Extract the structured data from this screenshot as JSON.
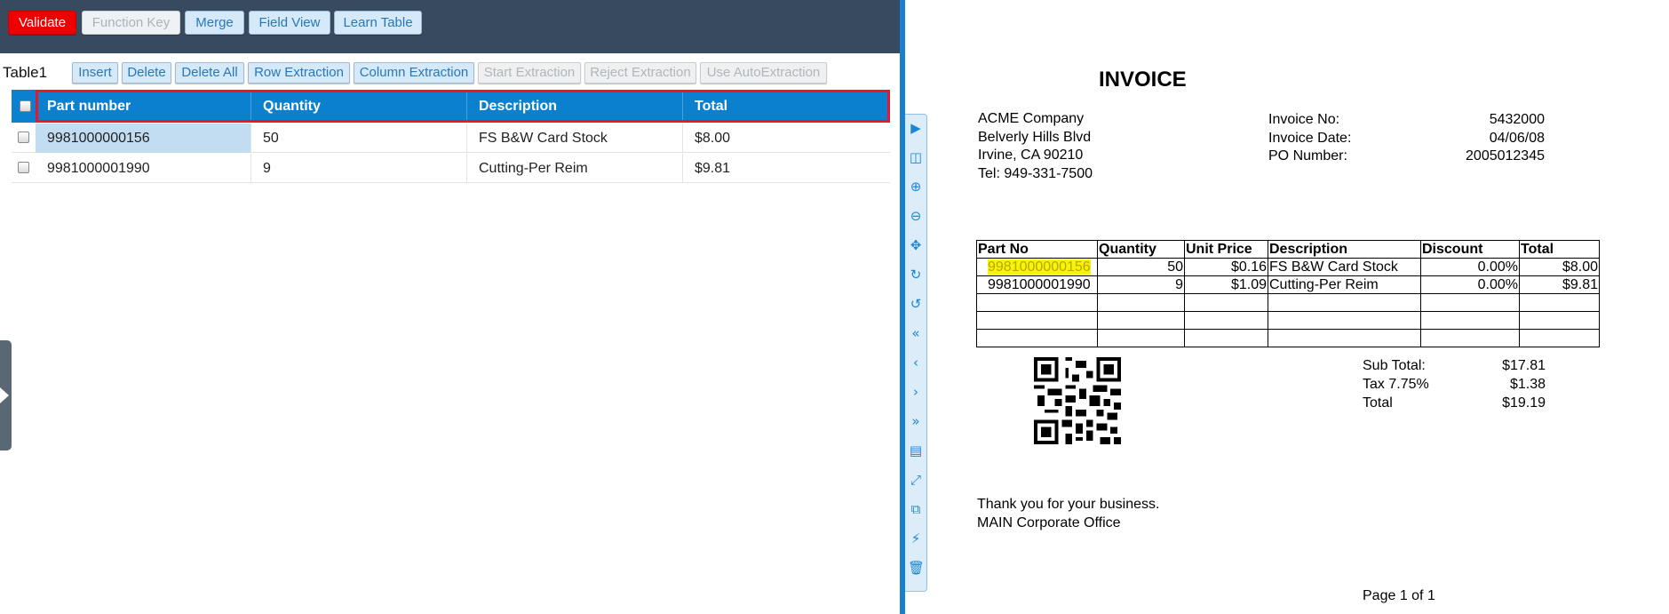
{
  "toolbar": {
    "validate": "Validate",
    "function_key": "Function Key",
    "merge": "Merge",
    "field_view": "Field View",
    "learn_table": "Learn Table"
  },
  "table": {
    "name": "Table1",
    "actions": {
      "insert": "Insert",
      "delete": "Delete",
      "delete_all": "Delete All",
      "row_extraction": "Row Extraction",
      "column_extraction": "Column Extraction",
      "start_extraction": "Start Extraction",
      "reject_extraction": "Reject Extraction",
      "use_autoextraction": "Use AutoExtraction"
    },
    "columns": [
      "Part number",
      "Quantity",
      "Description",
      "Total"
    ],
    "rows": [
      [
        "9981000000156",
        "50",
        "FS B&W Card Stock",
        "$8.00"
      ],
      [
        "9981000001990",
        "9",
        "Cutting-Per Reim",
        "$9.81"
      ]
    ]
  },
  "viewer_tools": [
    "play-icon",
    "split-view-icon",
    "zoom-in-icon",
    "zoom-out-icon",
    "pan-icon",
    "rotate-cw-icon",
    "rotate-ccw-icon",
    "first-page-icon",
    "prev-page-icon",
    "next-page-icon",
    "last-page-icon",
    "document-icon",
    "fit-icon",
    "copy-icon",
    "plug-icon",
    "trash-icon"
  ],
  "document": {
    "title": "INVOICE",
    "company": {
      "name": "ACME Company",
      "street": "Belverly Hills Blvd",
      "city": "Irvine, CA 90210",
      "tel": "Tel: 949-331-7500"
    },
    "meta": {
      "invoice_no_label": "Invoice No:",
      "invoice_no": "5432000",
      "invoice_date_label": "Invoice Date:",
      "invoice_date": "04/06/08",
      "po_label": "PO Number:",
      "po": "2005012345"
    },
    "table_headers": [
      "Part No",
      "Quantity",
      "Unit Price",
      "Description",
      "Discount",
      "Total"
    ],
    "table_rows": [
      [
        "9981000000156",
        "50",
        "$0.16",
        "FS B&W Card Stock",
        "0.00%",
        "$8.00"
      ],
      [
        "9981000001990",
        "9",
        "$1.09",
        "Cutting-Per Reim",
        "0.00%",
        "$9.81"
      ]
    ],
    "totals": {
      "sub_label": "Sub Total:",
      "sub": "$17.81",
      "tax_label": "Tax 7.75%",
      "tax": "$1.38",
      "total_label": "Total",
      "total": "$19.19"
    },
    "thanks": "Thank you for your business.",
    "office": "MAIN Corporate Office",
    "page": "Page 1 of 1"
  },
  "colors": {
    "topbar": "#374a5e",
    "header": "#0b80cf",
    "highlight": "#f7f40a",
    "outline": "#e8182a"
  }
}
